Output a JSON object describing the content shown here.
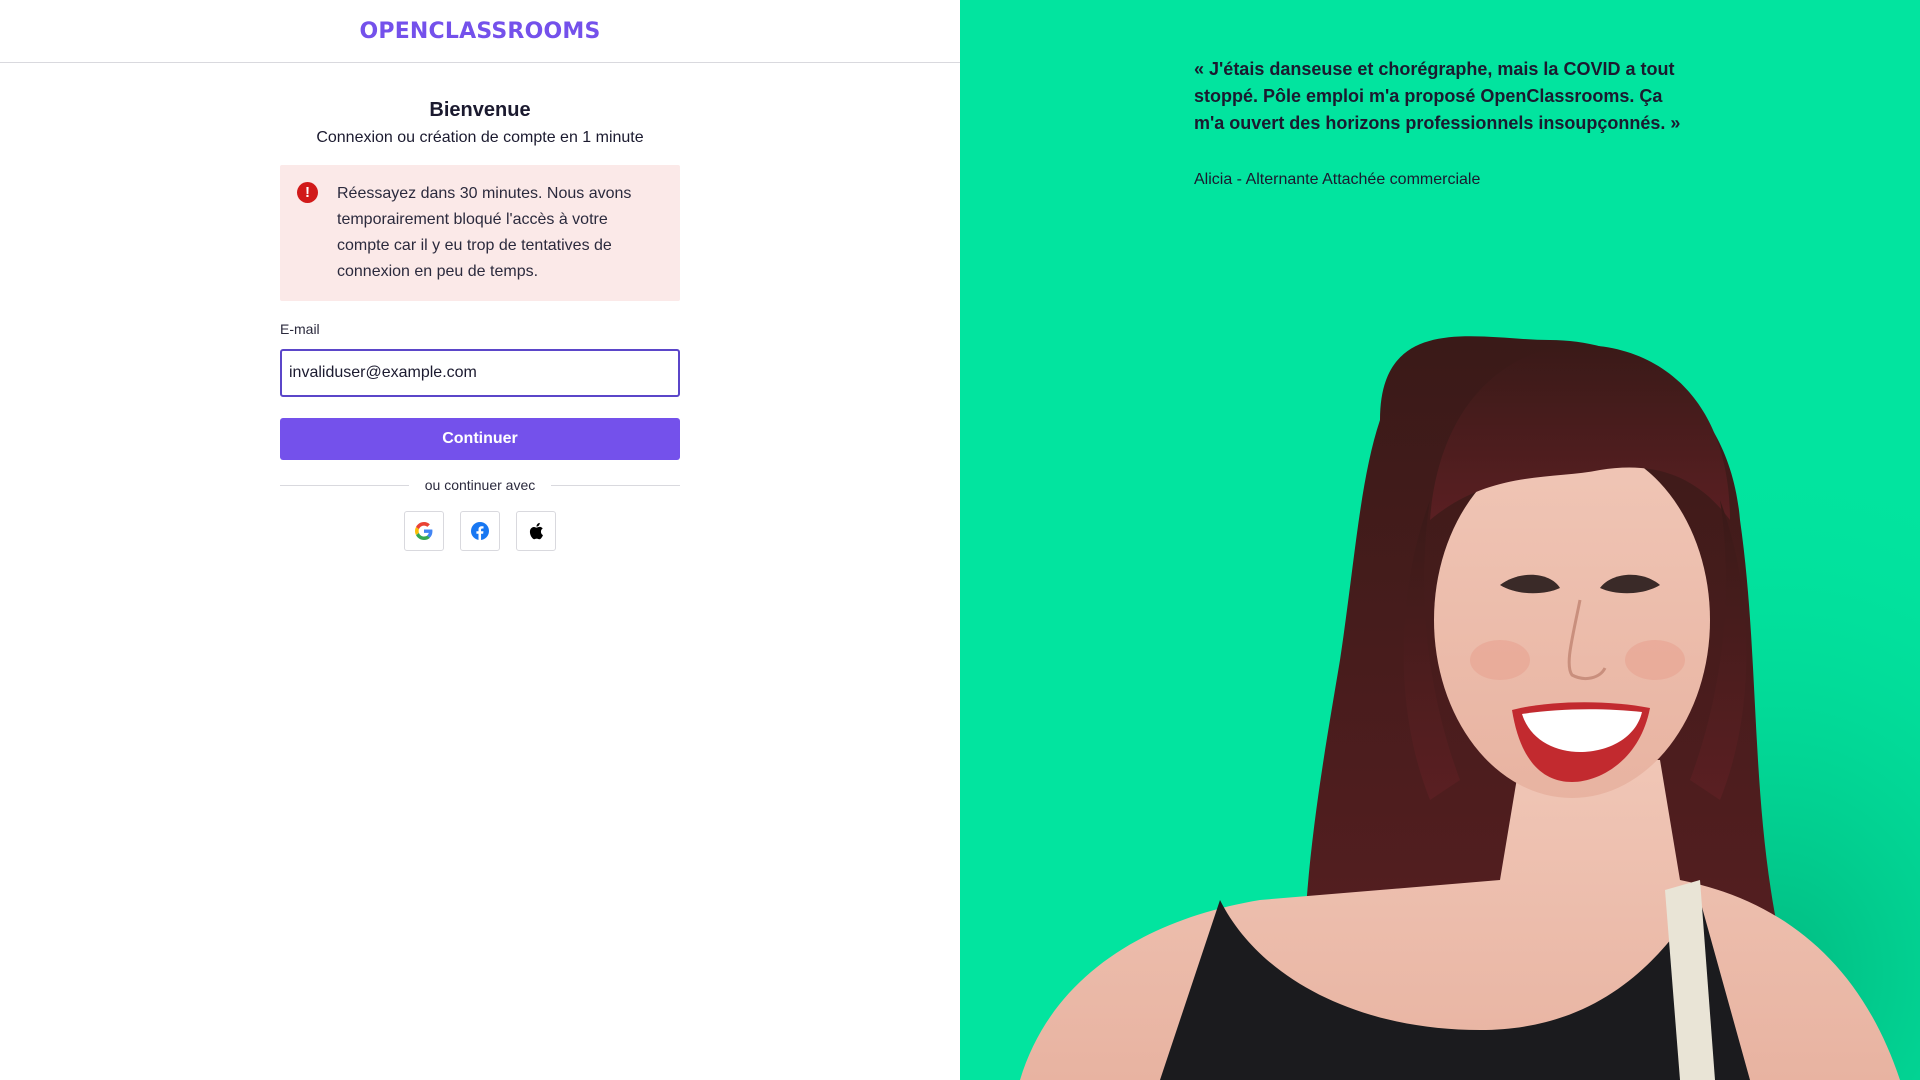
{
  "brand": {
    "logo_text": "OPENCLASSROOMS",
    "accent_color": "#7451eb"
  },
  "form": {
    "title": "Bienvenue",
    "subtitle": "Connexion ou création de compte en 1 minute",
    "alert": {
      "icon": "error-icon",
      "message": "Réessayez dans 30 minutes. Nous avons temporairement bloqué l'accès à votre compte car il y eu trop de tentatives de connexion en peu de temps."
    },
    "email_label": "E-mail",
    "email_value": "invaliduser@example.com",
    "continue_label": "Continuer",
    "divider_text": "ou continuer avec",
    "social": [
      "google-icon",
      "facebook-icon",
      "apple-icon"
    ]
  },
  "testimonial": {
    "quote": "« J'étais danseuse et chorégraphe, mais la COVID a tout stoppé. Pôle emploi m'a proposé OpenClassrooms. Ça m'a ouvert des horizons professionnels insoupçonnés. »",
    "author": "Alicia - Alternante Attachée commerciale",
    "background_color": "#02e49f"
  }
}
